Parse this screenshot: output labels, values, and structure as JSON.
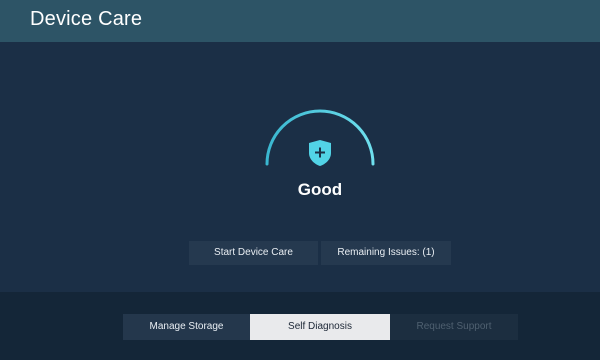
{
  "header": {
    "title": "Device Care"
  },
  "status": {
    "label": "Good",
    "icon": "shield-plus-icon",
    "accent_color": "#52d3e6"
  },
  "actions": {
    "start_label": "Start Device Care",
    "remaining_label": "Remaining Issues: (1)"
  },
  "tabs": [
    {
      "label": "Manage Storage",
      "state": "normal"
    },
    {
      "label": "Self Diagnosis",
      "state": "selected"
    },
    {
      "label": "Request Support",
      "state": "disabled"
    }
  ],
  "colors": {
    "header_bg": "#2d5466",
    "main_bg": "#1b2f46",
    "bottom_bg": "#142638",
    "selected_tab_bg": "#e9eaec"
  }
}
